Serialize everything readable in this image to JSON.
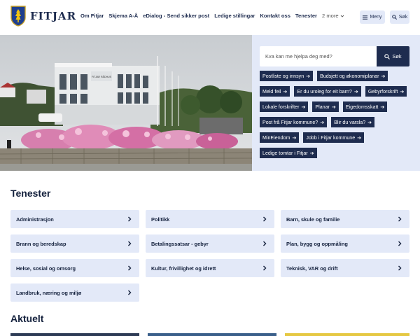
{
  "header": {
    "logo_text": "FITJAR",
    "nav": [
      "Om Fitjar",
      "Skjema A-Å",
      "eDialog - Send sikker post",
      "Ledige stillingar",
      "Kontakt oss",
      "Tenester"
    ],
    "more_label": "2 more",
    "menu_label": "Meny",
    "search_label": "Søk"
  },
  "hero": {
    "photo_sign": "FITJAR RÅDHUS",
    "search": {
      "placeholder": "Kva kan me hjelpa deg med?",
      "button_label": "Søk"
    },
    "quick_links": [
      "Postliste og innsyn",
      "Budsjett og økonomiplanar",
      "Meld feil",
      "Er du uroleg for eit barn?",
      "Gebyrforskrift",
      "Lokale forskrifter",
      "Planar",
      "Eigedomsskatt",
      "Post frå Fitjar kommune?",
      "Blir du varsla?",
      "MinEiendom",
      "Jobb i Fitjar kommune",
      "Ledige tomtar i Fitjar"
    ]
  },
  "tenester": {
    "title": "Tenester",
    "items": [
      "Administrasjon",
      "Politikk",
      "Barn, skule og familie",
      "Brann og beredskap",
      "Betalingssatsar - gebyr",
      "Plan, bygg og oppmåling",
      "Helse, sosial og omsorg",
      "Kultur, frivillighet og idrett",
      "Teknisk, VAR og drift",
      "Landbruk, næring og miljø"
    ]
  },
  "aktuelt": {
    "title": "Aktuelt"
  },
  "colors": {
    "navy": "#1e2c4f",
    "light_blue": "#e3e9f8"
  }
}
